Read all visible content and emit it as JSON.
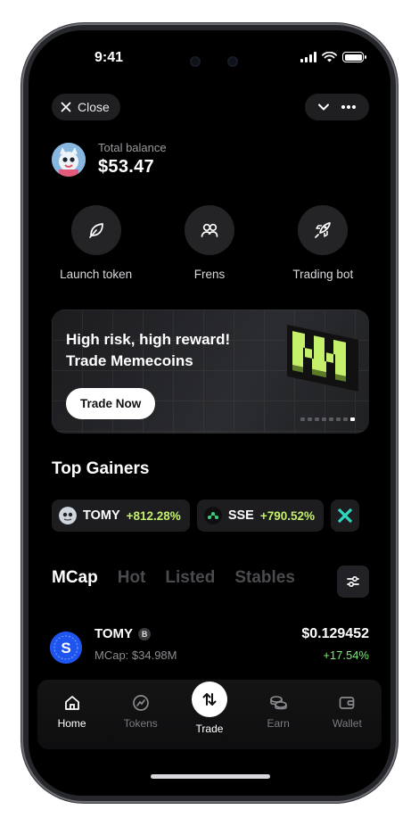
{
  "status_bar": {
    "time": "9:41"
  },
  "header": {
    "close_label": "Close"
  },
  "balance": {
    "label": "Total balance",
    "amount": "$53.47"
  },
  "actions": [
    {
      "label": "Launch token",
      "icon": "leaf-icon"
    },
    {
      "label": "Frens",
      "icon": "users-icon"
    },
    {
      "label": "Trading bot",
      "icon": "rocket-icon"
    }
  ],
  "banner": {
    "headline": "High risk, high reward!",
    "subheadline": "Trade Memecoins",
    "cta": "Trade Now",
    "active_dot": 7,
    "dot_count": 8,
    "accent": "#c5f06b"
  },
  "top_gainers": {
    "title": "Top Gainers",
    "items": [
      {
        "symbol": "TOMY",
        "change": "+812.28%"
      },
      {
        "symbol": "SSE",
        "change": "+790.52%"
      }
    ]
  },
  "market_tabs": [
    "MCap",
    "Hot",
    "Listed",
    "Stables"
  ],
  "active_tab": "MCap",
  "token_row": {
    "name": "TOMY",
    "badge": "B",
    "mcap": "MCap: $34.98M",
    "price": "$0.129452",
    "change": "+17.54%"
  },
  "bottom_nav": [
    {
      "label": "Home",
      "icon": "home-icon",
      "active": true
    },
    {
      "label": "Tokens",
      "icon": "tokens-icon",
      "active": false
    },
    {
      "label": "Trade",
      "icon": "swap-icon",
      "active": false
    },
    {
      "label": "Earn",
      "icon": "coins-icon",
      "active": false
    },
    {
      "label": "Wallet",
      "icon": "wallet-icon",
      "active": false
    }
  ]
}
